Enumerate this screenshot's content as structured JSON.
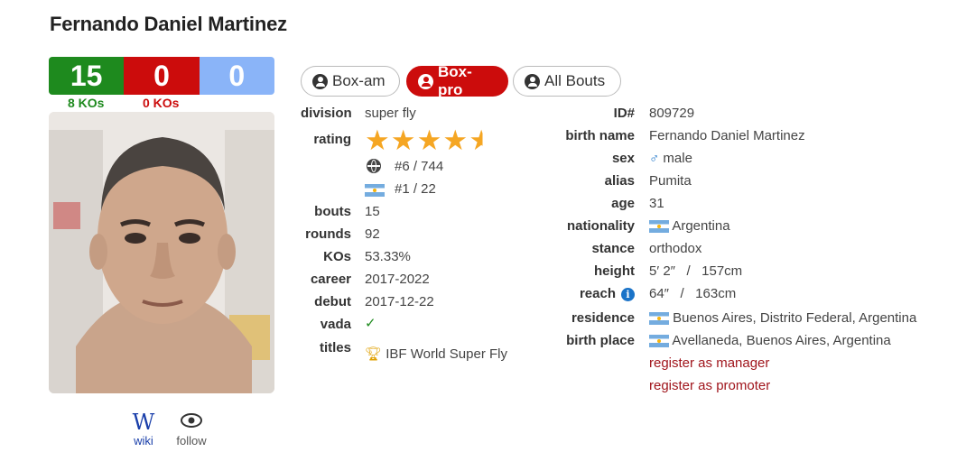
{
  "name": "Fernando Daniel Martinez",
  "record": {
    "wins": "15",
    "losses": "0",
    "draws": "0",
    "win_kos": "8 KOs",
    "loss_kos": "0 KOs"
  },
  "links": {
    "wiki": "wiki",
    "follow": "follow",
    "wiki_glyph": "W"
  },
  "tabs": [
    {
      "label": "Box-am",
      "icon": "user-circle-icon",
      "active": false
    },
    {
      "label": "Box-pro",
      "icon": "user-circle-icon",
      "active": true
    },
    {
      "label": "All Bouts",
      "icon": "user-circle-icon",
      "active": false
    }
  ],
  "left": {
    "division": {
      "label": "division",
      "value": "super fly"
    },
    "rating": {
      "label": "rating",
      "stars": 4.5,
      "world_rank": "#6 / 744",
      "country_rank": "#1 / 22"
    },
    "bouts": {
      "label": "bouts",
      "value": "15"
    },
    "rounds": {
      "label": "rounds",
      "value": "92"
    },
    "kos": {
      "label": "KOs",
      "value": "53.33%"
    },
    "career": {
      "label": "career",
      "value": "2017-2022"
    },
    "debut": {
      "label": "debut",
      "value": "2017-12-22"
    },
    "vada": {
      "label": "vada",
      "value": "✓"
    },
    "titles": {
      "label": "titles",
      "value": "IBF World Super Fly"
    }
  },
  "right": {
    "id": {
      "label": "ID#",
      "value": "809729"
    },
    "birth_name": {
      "label": "birth name",
      "value": "Fernando Daniel Martinez"
    },
    "sex": {
      "label": "sex",
      "value": "male",
      "symbol": "♂"
    },
    "alias": {
      "label": "alias",
      "value": "Pumita"
    },
    "age": {
      "label": "age",
      "value": "31"
    },
    "nationality": {
      "label": "nationality",
      "value": "Argentina"
    },
    "stance": {
      "label": "stance",
      "value": "orthodox"
    },
    "height": {
      "label": "height",
      "value": "5′ 2″   /   157cm"
    },
    "reach": {
      "label": "reach",
      "value": "64″   /   163cm",
      "info_glyph": "i"
    },
    "residence": {
      "label": "residence",
      "value": "Buenos Aires, Distrito Federal, Argentina"
    },
    "birth_place": {
      "label": "birth place",
      "value": "Avellaneda, Buenos Aires, Argentina"
    },
    "register_manager": "register as manager",
    "register_promoter": "register as promoter"
  },
  "colors": {
    "win": "#1e8a1e",
    "loss": "#cc0c0c",
    "draw": "#8ab4f8",
    "star": "#f5a623",
    "link": "#a0151c"
  }
}
